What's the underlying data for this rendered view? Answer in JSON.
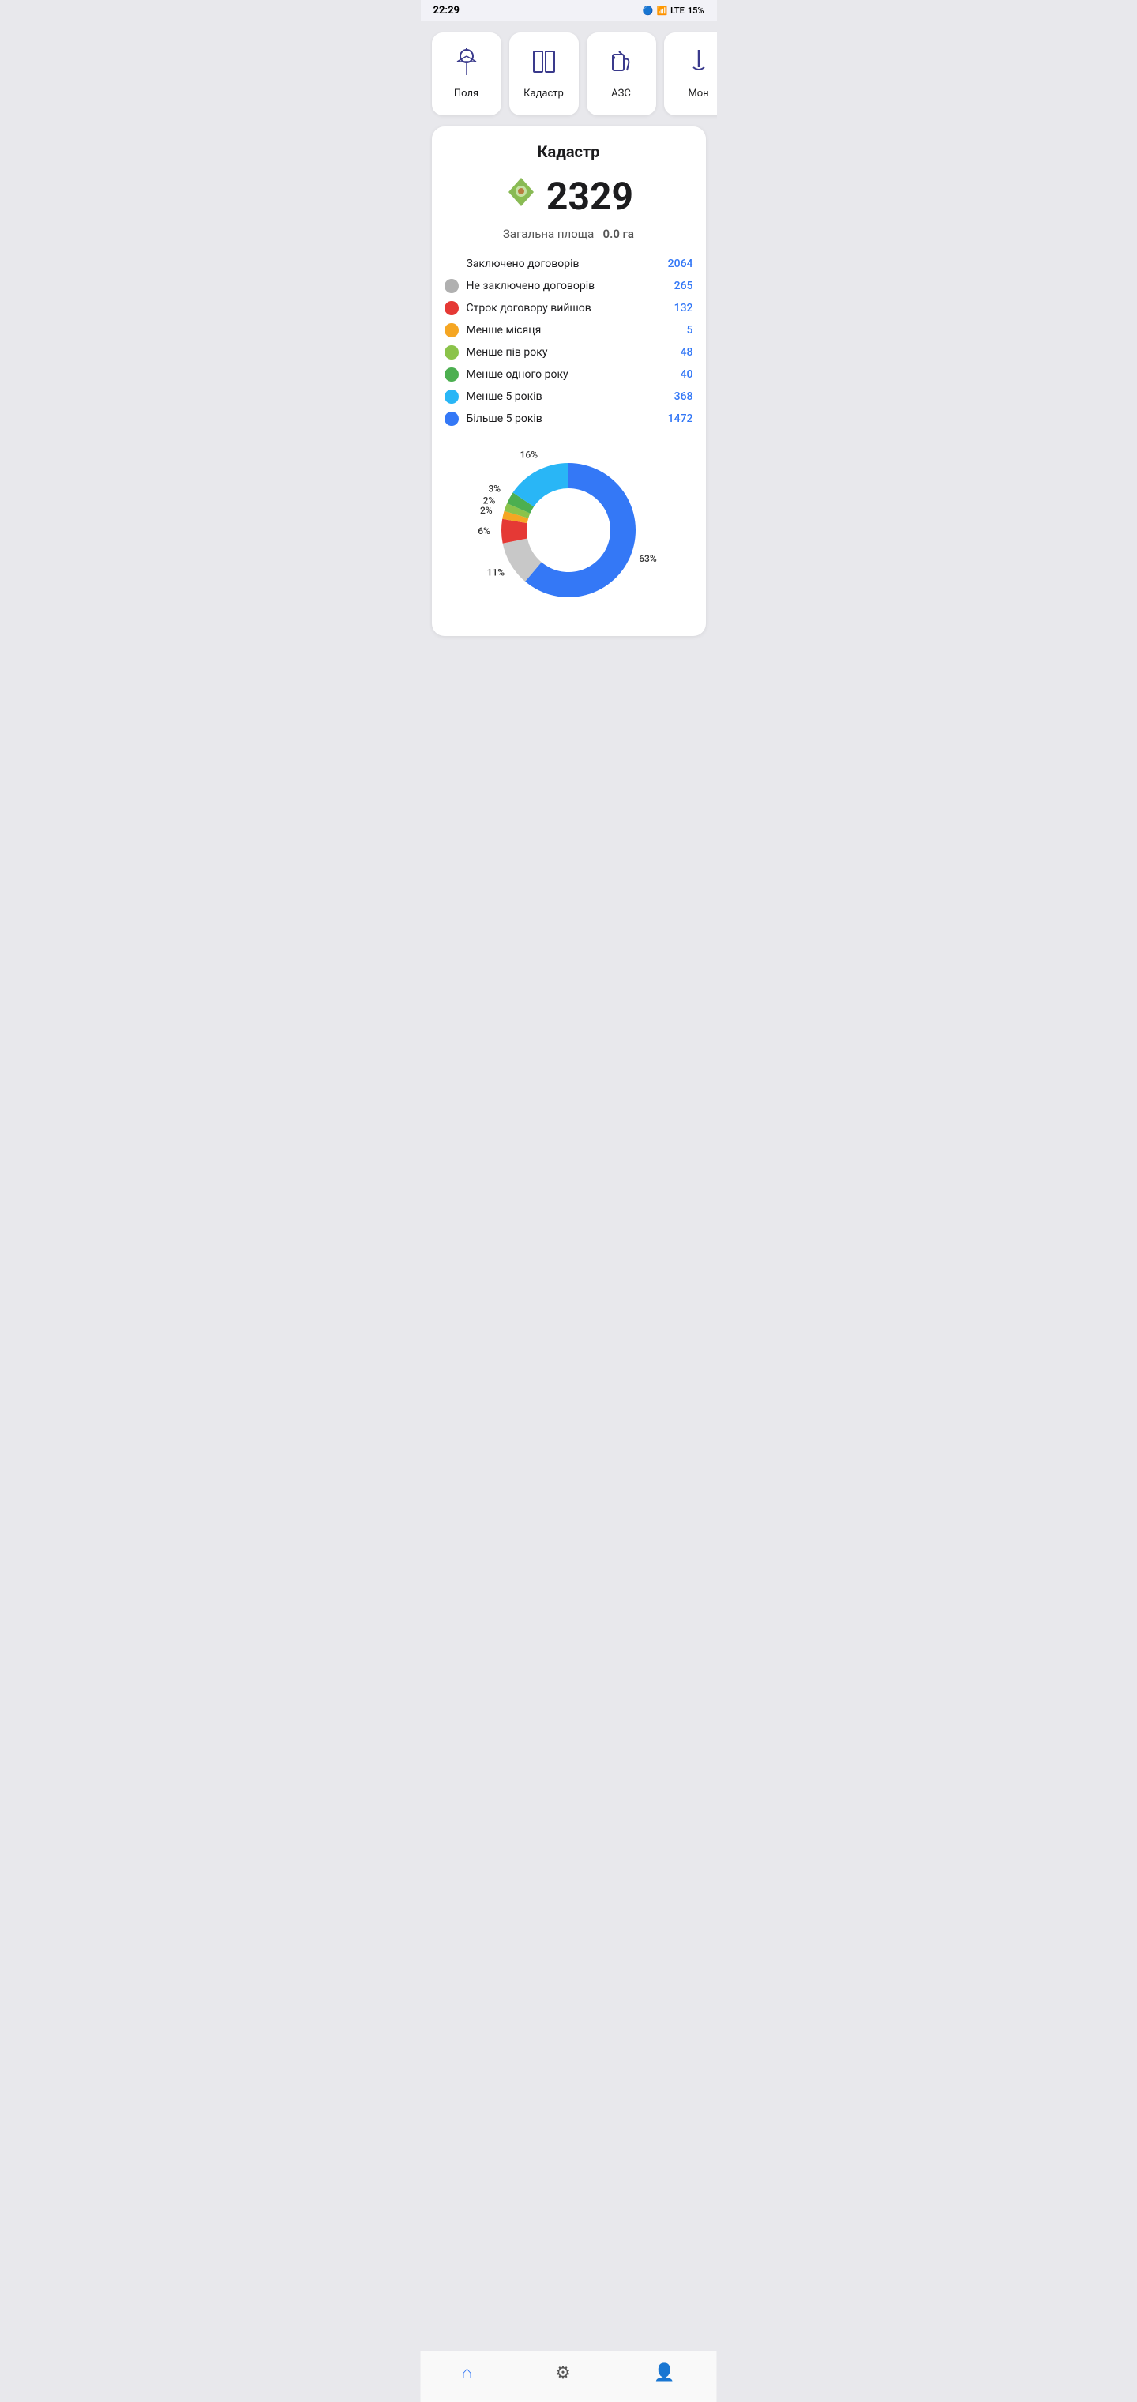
{
  "statusBar": {
    "time": "22:29",
    "battery": "15%",
    "network": "LTE"
  },
  "navCards": [
    {
      "id": "fields",
      "label": "Поля",
      "icon": "🌅"
    },
    {
      "id": "cadastre",
      "label": "Кадастр",
      "icon": "🗺️"
    },
    {
      "id": "gas",
      "label": "АЗС",
      "icon": "⛽"
    },
    {
      "id": "mop",
      "label": "Мон",
      "icon": "🧹"
    }
  ],
  "mainCard": {
    "title": "Кадастр",
    "heroNumber": "2329",
    "heroIcon": "📍",
    "totalAreaLabel": "Загальна площа",
    "totalAreaValue": "0.0 га",
    "stats": [
      {
        "id": "concluded",
        "dotColor": "transparent",
        "label": "Заключено договорів",
        "value": "2064"
      },
      {
        "id": "not-concluded",
        "dotColor": "#b0b0b0",
        "label": "Не заключено договорів",
        "value": "265"
      },
      {
        "id": "expired",
        "dotColor": "#e53935",
        "label": "Строк договору вийшов",
        "value": "132"
      },
      {
        "id": "less-month",
        "dotColor": "#f5a623",
        "label": "Менше місяця",
        "value": "5"
      },
      {
        "id": "less-half-year",
        "dotColor": "#8bc34a",
        "label": "Менше пів року",
        "value": "48"
      },
      {
        "id": "less-year",
        "dotColor": "#4caf50",
        "label": "Менше одного року",
        "value": "40"
      },
      {
        "id": "less-5years",
        "dotColor": "#29b6f6",
        "label": "Менше 5 років",
        "value": "368"
      },
      {
        "id": "more-5years",
        "dotColor": "#3478f6",
        "label": "Більше 5 років",
        "value": "1472"
      }
    ],
    "chart": {
      "segments": [
        {
          "id": "more-5years",
          "color": "#3478f6",
          "percent": 63,
          "label": "63%"
        },
        {
          "id": "not-concluded",
          "color": "#c8c8c8",
          "percent": 11,
          "label": "11%"
        },
        {
          "id": "expired",
          "color": "#e53935",
          "percent": 6,
          "label": "6%"
        },
        {
          "id": "less-month",
          "color": "#f5a623",
          "percent": 2,
          "label": "2%"
        },
        {
          "id": "less-half-year",
          "color": "#8bc34a",
          "percent": 2,
          "label": "2%"
        },
        {
          "id": "less-year",
          "color": "#4caf50",
          "percent": 3,
          "label": "3%"
        },
        {
          "id": "less-5years",
          "color": "#29b6f6",
          "percent": 16,
          "label": "16%"
        }
      ]
    }
  },
  "bottomNav": [
    {
      "id": "home",
      "icon": "⌂",
      "label": "Home",
      "active": true
    },
    {
      "id": "settings",
      "icon": "⚙",
      "label": "Settings",
      "active": false
    },
    {
      "id": "profile",
      "icon": "👤",
      "label": "Profile",
      "active": false
    }
  ]
}
